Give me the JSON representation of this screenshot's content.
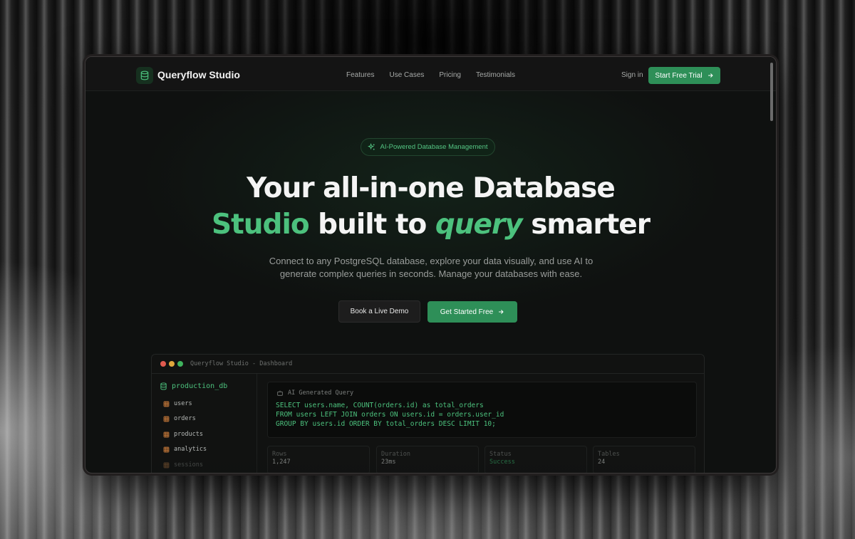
{
  "nav": {
    "brand": "Queryflow Studio",
    "links": [
      "Features",
      "Use Cases",
      "Pricing",
      "Testimonials"
    ],
    "sign_in": "Sign in",
    "cta": "Start Free Trial"
  },
  "hero": {
    "badge": "AI-Powered Database Management",
    "headline_line1": "Your all-in-one Database",
    "headline_line2_green": "Studio",
    "headline_line2_mid": " built to ",
    "headline_line2_italic": "query",
    "headline_line2_end": " smarter",
    "subtitle_line1": "Connect to any PostgreSQL database, explore your data visually, and use AI to",
    "subtitle_line2": "generate complex queries in seconds. Manage your databases with ease.",
    "secondary_button": "Book a Live Demo",
    "primary_button": "Get Started Free"
  },
  "dashboard": {
    "window_title": "Queryflow Studio - Dashboard",
    "database": "production_db",
    "tables": [
      "users",
      "orders",
      "products",
      "analytics",
      "sessions"
    ],
    "ai_label": "AI Generated Query",
    "sql_lines": [
      "SELECT users.name, COUNT(orders.id) as total_orders",
      "FROM users LEFT JOIN orders ON users.id = orders.user_id",
      "GROUP BY users.id ORDER BY total_orders DESC LIMIT 10;"
    ],
    "stats": [
      {
        "label": "Rows",
        "value": "1,247"
      },
      {
        "label": "Duration",
        "value": "23ms"
      },
      {
        "label": "Status",
        "value": "Success"
      },
      {
        "label": "Tables",
        "value": "24"
      }
    ]
  },
  "colors": {
    "accent": "#2e8f58",
    "accent_text": "#4cc17d",
    "window_close": "#e05a4f",
    "window_minimize": "#e0a73c",
    "window_maximize": "#3fb35d"
  }
}
